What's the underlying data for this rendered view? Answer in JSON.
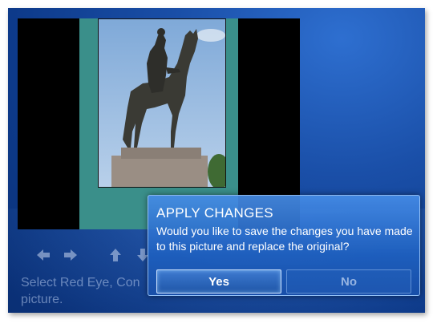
{
  "dialog": {
    "title": "APPLY CHANGES",
    "message": "Would you like to save the changes you have made to this picture and replace the original?",
    "yes_label": "Yes",
    "no_label": "No"
  },
  "hint_text": "Select Red Eye, Con… picture.",
  "hint_line1": "Select Red Eye, Con",
  "hint_line2": "picture.",
  "nav_icons": [
    "arrow-left-icon",
    "arrow-right-icon",
    "arrow-up-icon",
    "arrow-down-icon"
  ],
  "colors": {
    "background": "#0d3a8a",
    "dialog": "#2a6ac4",
    "accent": "#cfe4ff"
  }
}
